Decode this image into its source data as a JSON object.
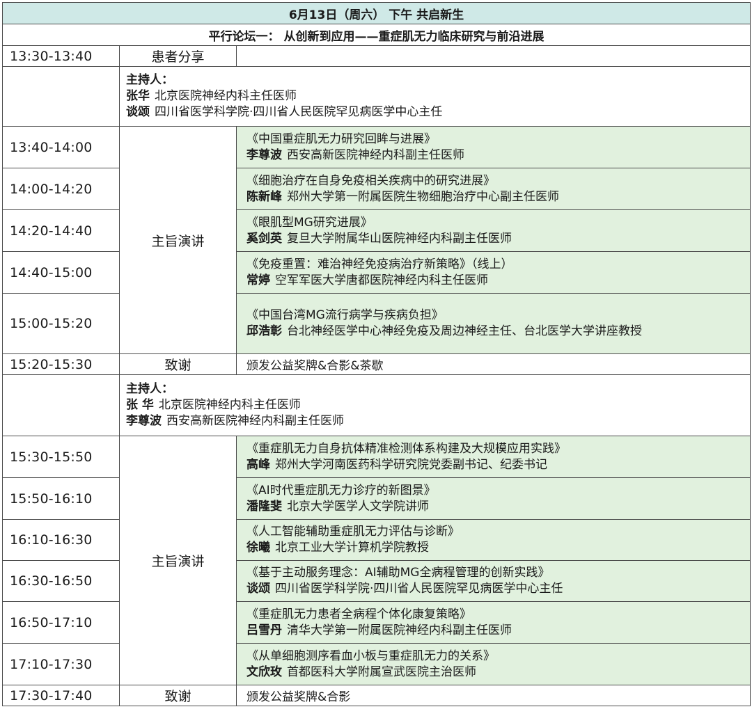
{
  "header": {
    "date_title": "6月13日（周六） 下午 共启新生",
    "forum_title": "平行论坛一： 从创新到应用——重症肌无力临床研究与前沿进展"
  },
  "rows": {
    "r1": {
      "time": "13:30-13:40",
      "label": "患者分享"
    },
    "host1": {
      "title": "主持人：",
      "h1_name": "张华",
      "h1_desc": "北京医院神经内科主任医师",
      "h2_name": "谈颂",
      "h2_desc": "四川省医学科学院·四川省人民医院罕见病医学中心主任"
    },
    "keynote_label": "主旨演讲",
    "t1": {
      "time": "13:40-14:00",
      "title": "《中国重症肌无力研究回眸与进展》",
      "name": "李尊波",
      "desc": "西安高新医院神经内科副主任医师"
    },
    "t2": {
      "time": "14:00-14:20",
      "title": "《细胞治疗在自身免疫相关疾病中的研究进展》",
      "name": "陈新峰",
      "desc": "郑州大学第一附属医院生物细胞治疗中心副主任医师"
    },
    "t3": {
      "time": "14:20-14:40",
      "title": "《眼肌型MG研究进展》",
      "name": "奚剑英",
      "desc": "复旦大学附属华山医院神经内科副主任医师"
    },
    "t4": {
      "time": "14:40-15:00",
      "title": "《免疫重置：难治神经免疫病治疗新策略》（线上）",
      "name": "常婷",
      "desc": "空军军医大学唐都医院神经内科主任医师"
    },
    "t5": {
      "time": "15:00-15:20",
      "title": "《中国台湾MG流行病学与疾病负担》",
      "name": "邱浩彰",
      "desc": "台北神经医学中心神经免疫及周边神经主任、台北医学大学讲座教授"
    },
    "r_thanks1": {
      "time": "15:20-15:30",
      "label": "致谢",
      "text": "颁发公益奖牌&合影&茶歇"
    },
    "host2": {
      "title": "主持人：",
      "h1_name": "张 华",
      "h1_desc": "北京医院神经内科主任医师",
      "h2_name": "李尊波",
      "h2_desc": "西安高新医院神经内科副主任医师"
    },
    "t6": {
      "time": "15:30-15:50",
      "title": "《重症肌无力自身抗体精准检测体系构建及大规模应用实践》",
      "name": "高峰",
      "desc": "郑州大学河南医药科学研究院党委副书记、纪委书记"
    },
    "t7": {
      "time": "15:50-16:10",
      "title": "《AI时代重症肌无力诊疗的新图景》",
      "name": "潘隆斐",
      "desc": "北京大学医学人文学院讲师"
    },
    "t8": {
      "time": "16:10-16:30",
      "title": "《人工智能辅助重症肌无力评估与诊断》",
      "name": "徐曦",
      "desc": "北京工业大学计算机学院教授"
    },
    "t9": {
      "time": "16:30-16:50",
      "title": "《基于主动服务理念：AI辅助MG全病程管理的创新实践》",
      "name": "谈颂",
      "desc": "四川省医学科学院·四川省人民医院罕见病医学中心主任"
    },
    "t10": {
      "time": "16:50-17:10",
      "title": "《重症肌无力患者全病程个体化康复策略》",
      "name": "吕雪丹",
      "desc": "清华大学第一附属医院神经内科副主任医师"
    },
    "t11": {
      "time": "17:10-17:30",
      "title": "《从单细胞测序看血小板与重症肌无力的关系》",
      "name": "文欣玫",
      "desc": "首都医科大学附属宣武医院主治医师"
    },
    "r_thanks2": {
      "time": "17:30-17:40",
      "label": "致谢",
      "text": "颁发公益奖牌&合影"
    }
  }
}
